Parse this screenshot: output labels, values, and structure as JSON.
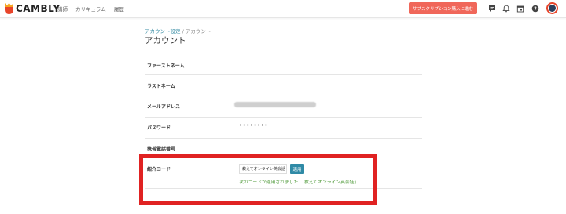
{
  "app": {
    "logo_text": "CAMBLY"
  },
  "nav": {
    "items": [
      "講師",
      "カリキュラム",
      "履歴"
    ]
  },
  "header": {
    "subscribe_label": "サブスクリプション購入に進む"
  },
  "breadcrumb": {
    "parent": "アカウント設定",
    "separator": "/",
    "current": "アカウント"
  },
  "page": {
    "title": "アカウント"
  },
  "form": {
    "first_name_label": "ファーストネーム",
    "last_name_label": "ラストネーム",
    "email_label": "メールアドレス",
    "password_label": "パスワード",
    "password_value": "••••••••",
    "phone_label": "携帯電話番号",
    "referral_label": "紹介コード",
    "referral_value": "教えてオンライン英会話",
    "apply_label": "適用",
    "applied_message": "次のコードが適用されました 「教えてオンライン英会話」"
  },
  "colors": {
    "accent": "#2f8aa6",
    "subscribe": "#f0675a",
    "success": "#4f9a3a",
    "highlight": "#e02222"
  },
  "icons": [
    "chat-icon",
    "bell-icon",
    "calendar-icon",
    "help-icon",
    "avatar"
  ]
}
